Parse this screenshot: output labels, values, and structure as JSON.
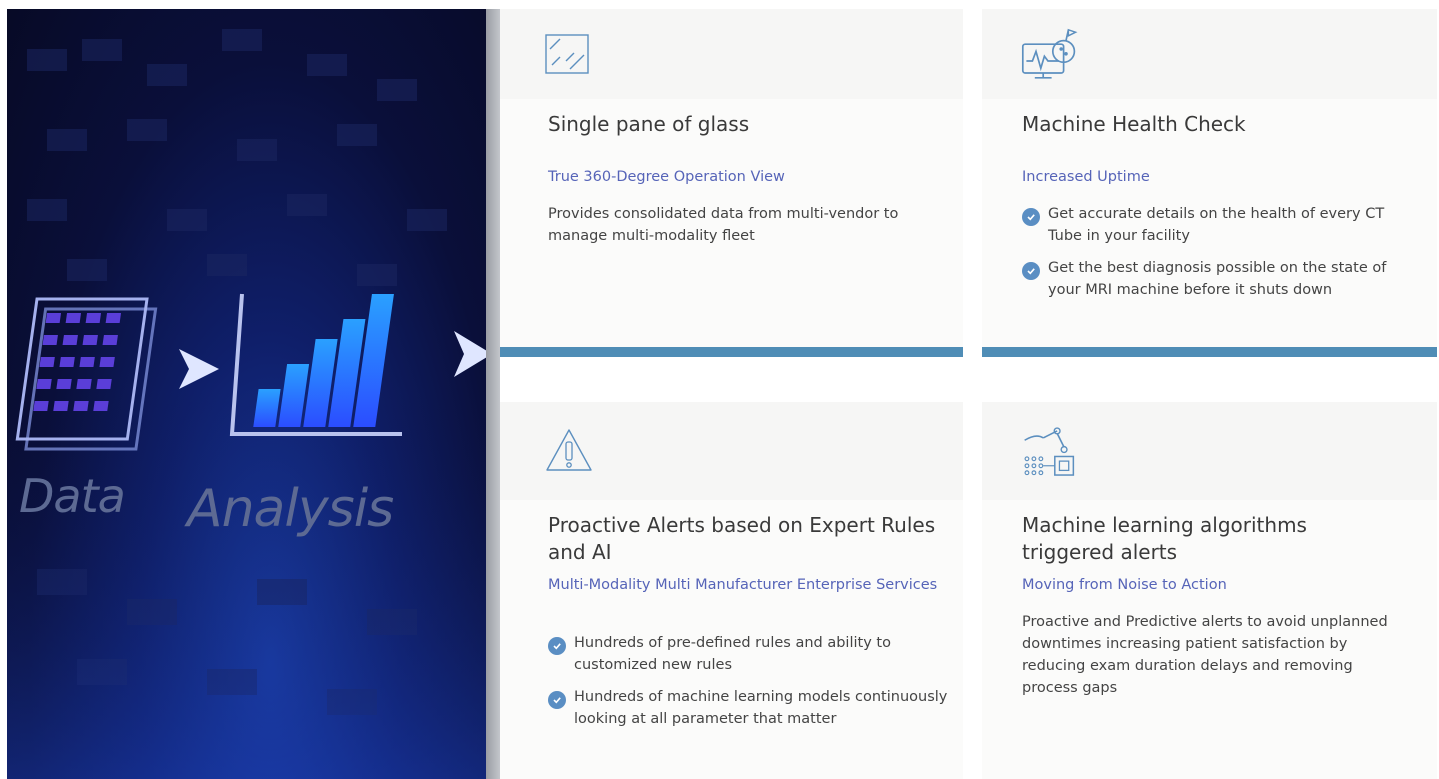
{
  "hero": {
    "label_data": "Data",
    "label_analysis": "Analysis"
  },
  "cards": [
    {
      "icon": "glass-pane-icon",
      "title": "Single pane of glass",
      "subtitle": "True 360-Degree Operation View",
      "description": "Provides consolidated data from multi-vendor to manage multi-modality fleet"
    },
    {
      "icon": "machine-health-icon",
      "title": "Machine Health Check",
      "subtitle": "Increased Uptime",
      "bullets": [
        "Get accurate details on the health of every CT Tube in your facility",
        "Get the best diagnosis possible on the state of your MRI machine before it shuts down"
      ]
    },
    {
      "icon": "warning-icon",
      "title": "Proactive Alerts based on Expert Rules and AI",
      "subtitle": "Multi-Modality Multi Manufacturer Enterprise Services",
      "bullets": [
        "Hundreds of pre-defined rules and ability to customized new rules",
        "Hundreds of machine learning models continuously looking at all parameter that matter"
      ]
    },
    {
      "icon": "robot-arm-chip-icon",
      "title": "Machine learning algorithms triggered alerts",
      "subtitle": "Moving from Noise to Action",
      "description": "Proactive and Predictive alerts to avoid unplanned downtimes increasing patient satisfaction by reducing exam duration delays and removing process gaps"
    }
  ],
  "colors": {
    "accent_bar": "#4f8db6",
    "subtitle": "#5664b8",
    "check": "#5a8ec3"
  }
}
